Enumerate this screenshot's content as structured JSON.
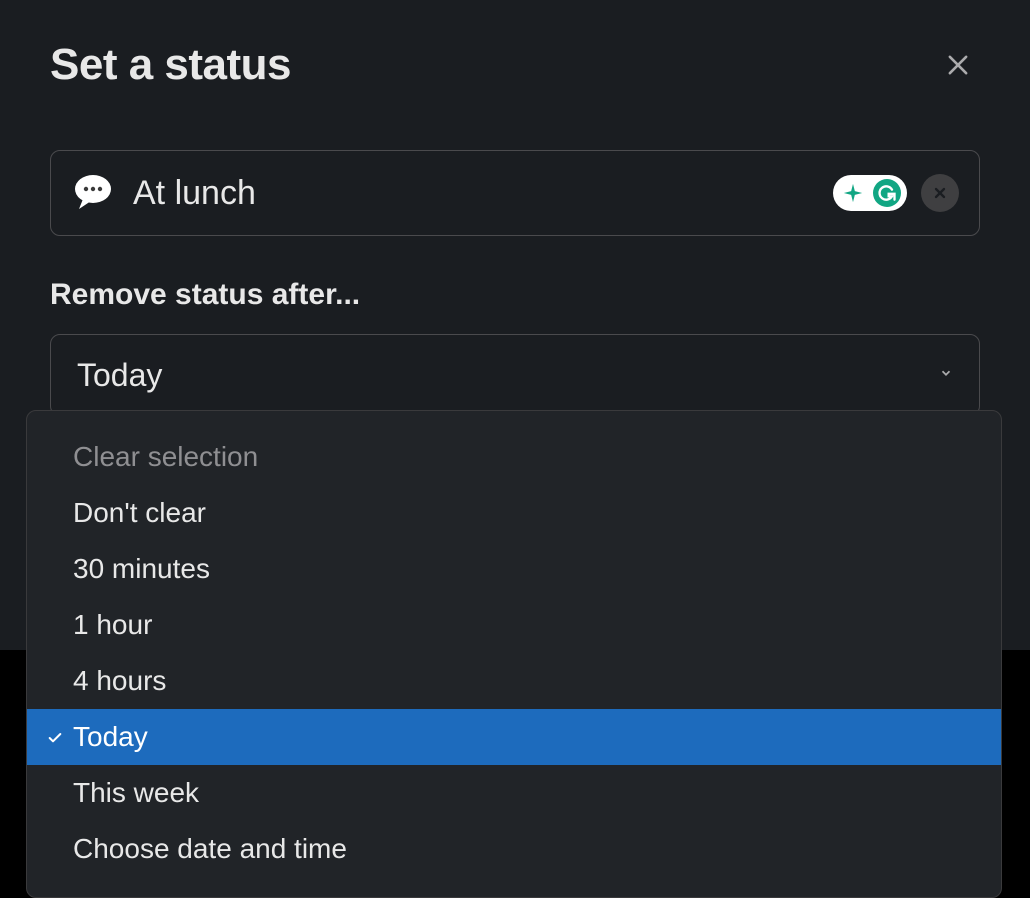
{
  "modal": {
    "title": "Set a status",
    "remove_after_label": "Remove status after...",
    "status_value": "At lunch"
  },
  "select": {
    "value": "Today"
  },
  "dropdown": {
    "header": "Clear selection",
    "options": [
      "Don't clear",
      "30 minutes",
      "1 hour",
      "4 hours",
      "Today",
      "This week",
      "Choose date and time"
    ],
    "selected_index": 4
  },
  "icons": {
    "close": "close-icon",
    "emoji": "speech-balloon-icon",
    "grammarly": "grammarly-icon",
    "clear_input": "x-icon",
    "chevron": "chevron-down-icon",
    "check": "check-icon"
  },
  "colors": {
    "bg": "#1a1d21",
    "text": "#e8e8e8",
    "border": "#4a4a4d",
    "highlight": "#1d6bbd",
    "teal": "#11a683"
  }
}
